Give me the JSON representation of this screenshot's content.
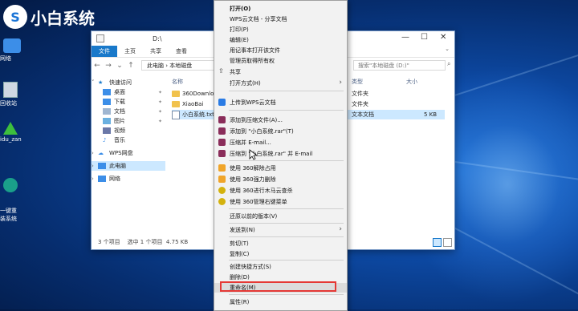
{
  "desktop": {
    "logo_text": "小白系统",
    "icons": [
      {
        "label": "网络"
      },
      {
        "label": "回收站"
      },
      {
        "label": "idu_zan"
      },
      {
        "label": "一键重\n装系统"
      }
    ]
  },
  "explorer": {
    "title": "D:\\",
    "ribbon_tabs": [
      "文件",
      "主页",
      "共享",
      "查看"
    ],
    "breadcrumb": [
      "此电脑",
      "本地磁盘"
    ],
    "search_placeholder": "搜索\"本地磁盘 (D:)\"",
    "sidebar": [
      {
        "label": "快速访问",
        "pinned": false
      },
      {
        "label": "桌面",
        "pinned": true
      },
      {
        "label": "下载",
        "pinned": true
      },
      {
        "label": "文档",
        "pinned": true
      },
      {
        "label": "图片",
        "pinned": true
      },
      {
        "label": "视频",
        "pinned": false
      },
      {
        "label": "音乐",
        "pinned": false
      },
      {
        "label": "WPS网盘",
        "pinned": false
      },
      {
        "label": "此电脑",
        "pinned": false
      },
      {
        "label": "网络",
        "pinned": false
      }
    ],
    "columns": {
      "name": "名称",
      "type": "类型",
      "size": "大小"
    },
    "files": [
      {
        "name": "360Downlo",
        "type": "文件夹",
        "size": ""
      },
      {
        "name": "XiaoBai",
        "type": "文件夹",
        "size": ""
      },
      {
        "name": "小白系统.txt",
        "type": "文本文档",
        "size": "5 KB"
      }
    ],
    "status": "3 个项目    选中 1 个项目  4.75 KB"
  },
  "context_menu": {
    "items": [
      {
        "label": "打开(O)",
        "bold": true
      },
      {
        "label": "WPS云文档 - 分享文档"
      },
      {
        "label": "打印(P)"
      },
      {
        "label": "编辑(E)"
      },
      {
        "label": "用记事本打开该文件"
      },
      {
        "label": "管理员取得所有权"
      },
      {
        "label": "共享"
      },
      {
        "label": "打开方式(H)",
        "submenu": true
      },
      {
        "label": "上传到WPS云文档"
      },
      {
        "label": "添加到压缩文件(A)..."
      },
      {
        "label": "添加到 \"小白系统.rar\"(T)"
      },
      {
        "label": "压缩并 E-mail..."
      },
      {
        "label": "压缩到 \"小白系统.rar\" 并 E-mail"
      },
      {
        "label": "使用 360解除占用"
      },
      {
        "label": "使用 360强力删除"
      },
      {
        "label": "使用 360进行木马云查杀"
      },
      {
        "label": "使用 360管理右键菜单"
      },
      {
        "label": "还原以前的版本(V)"
      },
      {
        "label": "发送到(N)",
        "submenu": true
      },
      {
        "label": "剪切(T)"
      },
      {
        "label": "复制(C)"
      },
      {
        "label": "创建快捷方式(S)"
      },
      {
        "label": "删除(D)"
      },
      {
        "label": "重命名(M)"
      },
      {
        "label": "属性(R)"
      }
    ]
  },
  "colors": {
    "highlight_box": "#e53935",
    "ribbon_file": "#1979ca",
    "selection": "#cce8ff"
  }
}
